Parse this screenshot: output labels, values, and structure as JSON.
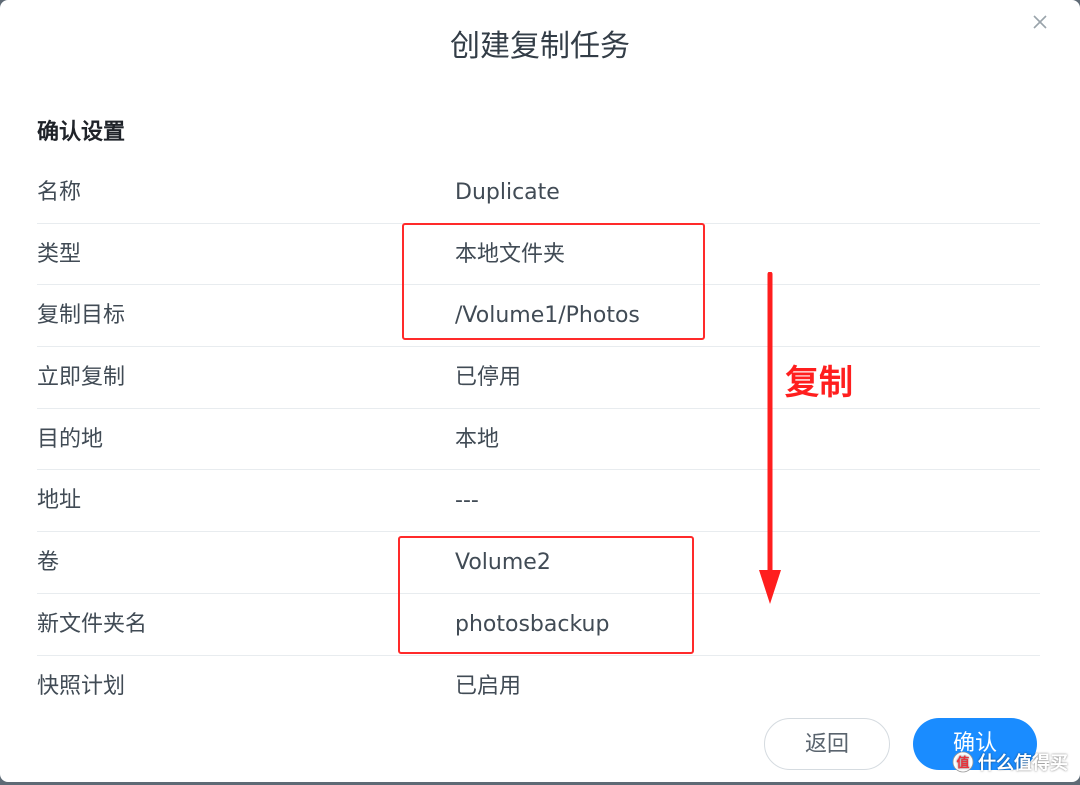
{
  "dialog": {
    "title": "创建复制任务",
    "section_title": "确认设置"
  },
  "settings": [
    {
      "label": "名称",
      "value": "Duplicate"
    },
    {
      "label": "类型",
      "value": "本地文件夹"
    },
    {
      "label": "复制目标",
      "value": "/Volume1/Photos"
    },
    {
      "label": "立即复制",
      "value": "已停用"
    },
    {
      "label": "目的地",
      "value": "本地"
    },
    {
      "label": "地址",
      "value": "---"
    },
    {
      "label": "卷",
      "value": "Volume2"
    },
    {
      "label": "新文件夹名",
      "value": "photosbackup"
    },
    {
      "label": "快照计划",
      "value": "已启用"
    }
  ],
  "annotation": {
    "text": "复制",
    "color": "#ff1e1e"
  },
  "buttons": {
    "back_label": "返回",
    "confirm_label": "确认"
  },
  "watermark": {
    "text": "什么值得买",
    "icon": "smzdm-logo-icon"
  },
  "colors": {
    "primary": "#1a8cff",
    "annotation": "#ff2a2a"
  }
}
